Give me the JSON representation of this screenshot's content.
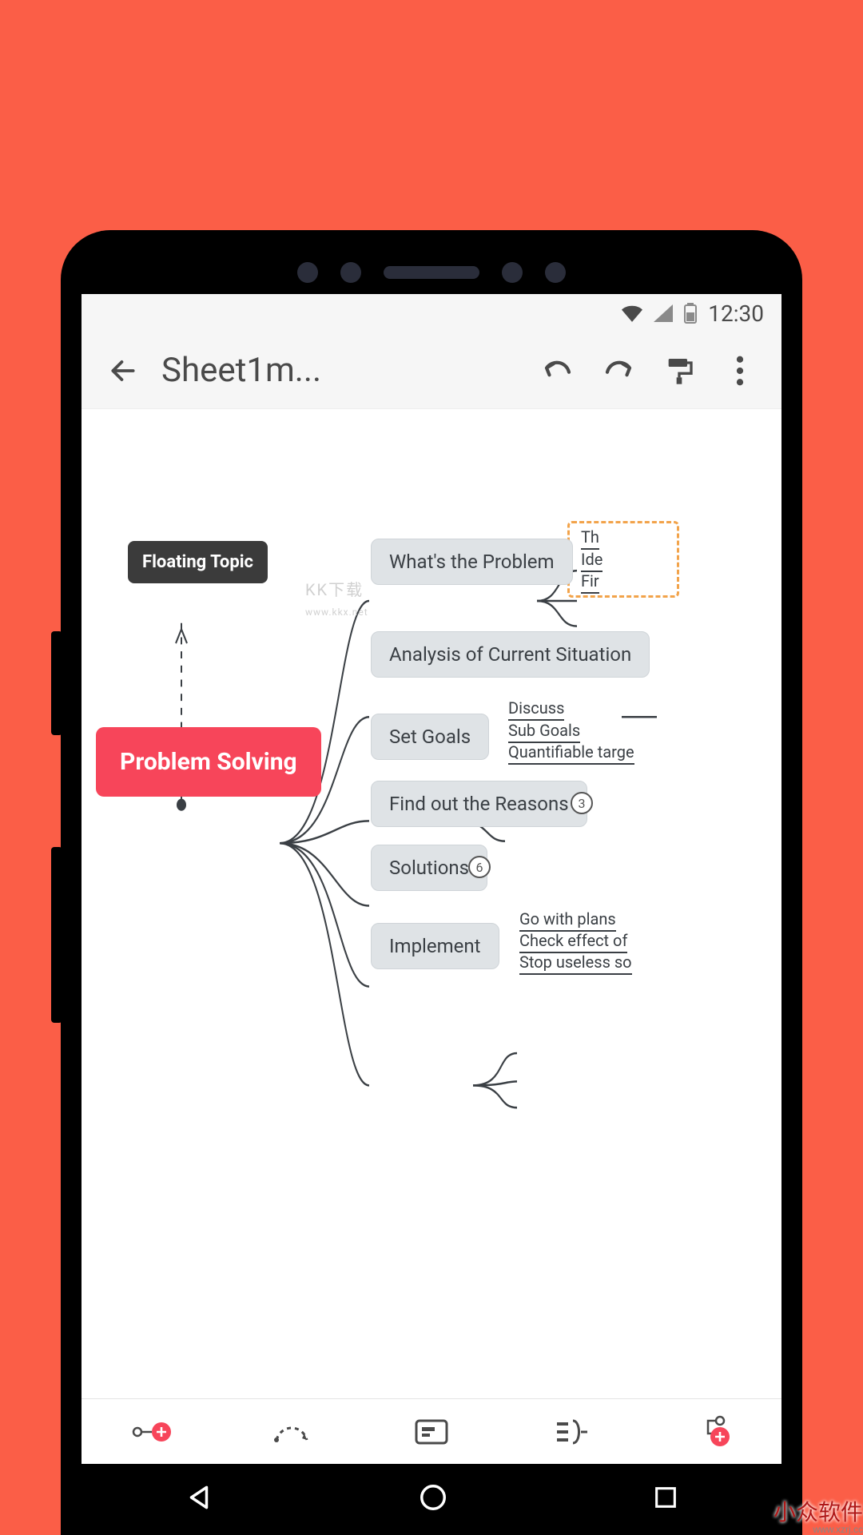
{
  "status": {
    "time": "12:30"
  },
  "appbar": {
    "title": "Sheet1m...",
    "back_icon": "arrow-left",
    "undo_icon": "undo",
    "redo_icon": "redo",
    "style_icon": "paint-roller",
    "more_icon": "more-vert"
  },
  "mindmap": {
    "floating_topic": "Floating Topic",
    "root": "Problem Solving",
    "branches": [
      {
        "label": "What's the Problem",
        "children": [
          "Th",
          "Ide",
          "Fir"
        ],
        "dashed": true
      },
      {
        "label": "Analysis of Current Situation",
        "children": []
      },
      {
        "label": "Set Goals",
        "children": [
          "Discuss",
          "Sub Goals",
          "Quantifiable targe"
        ]
      },
      {
        "label": "Find out the Reasons",
        "count": "3"
      },
      {
        "label": "Solutions",
        "count": "6"
      },
      {
        "label": "Implement",
        "children": [
          "Go with plans",
          "Check effect of",
          "Stop useless so"
        ]
      }
    ]
  },
  "watermark": {
    "main": "KK下载",
    "sub": "www.kkx.net"
  },
  "toolbar": {
    "add_node": "add-node",
    "relation": "relation",
    "note": "note",
    "summary": "summary",
    "add_subtopic": "add-subtopic"
  },
  "corner": {
    "text": "小众软件",
    "url": "www.xzrj.cc"
  }
}
